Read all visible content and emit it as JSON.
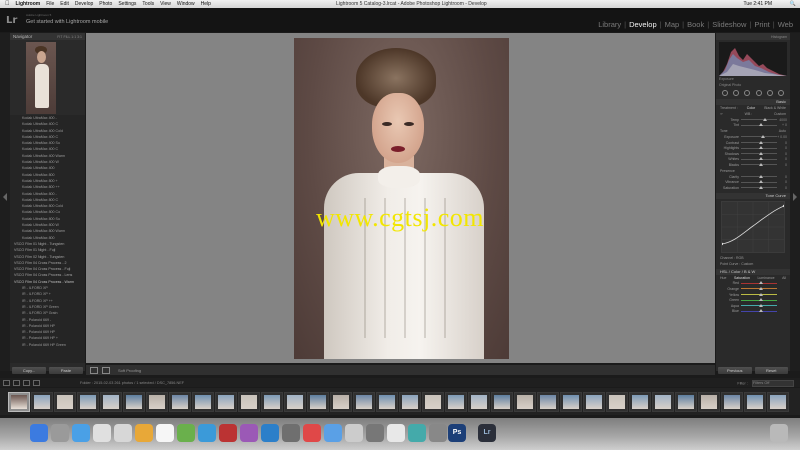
{
  "menubar": {
    "apple": "",
    "app": "Lightroom",
    "items": [
      "File",
      "Edit",
      "Develop",
      "Photo",
      "Settings",
      "Tools",
      "View",
      "Window",
      "Help"
    ],
    "window_title": "Lightroom 5 Catalog-3.lrcat - Adobe Photoshop Lightroom - Develop",
    "clock": "Tue 2:41 PM"
  },
  "identity": {
    "logo": "Lr",
    "small": "Adobe Lightroom 5",
    "text": "Get started with Lightroom mobile",
    "modules": [
      "Library",
      "Develop",
      "Map",
      "Book",
      "Slideshow",
      "Print",
      "Web"
    ],
    "active_module": "Develop"
  },
  "left_panel": {
    "navigator_title": "Navigator",
    "navigator_zoom": "FIT  FILL  1:1  3:1",
    "presets": [
      "Kodak UltraMax 400 -",
      "Kodak UltraMax 400 C",
      "Kodak UltraMax 400 Cold",
      "Kodak UltraMax 400 C",
      "Kodak UltraMax 400 Su",
      "Kodak UltraMax 400 C",
      "Kodak UltraMax 400 Warm",
      "Kodak UltraMax 400 W",
      "Kodak UltraMax 400",
      "Kodak UltraMax 800",
      "Kodak UltraMax 800 +",
      "Kodak UltraMax 800 ++",
      "Kodak UltraMax 800 -",
      "Kodak UltraMax 800 C",
      "Kodak UltraMax 800 Cold",
      "Kodak UltraMax 800 Co",
      "Kodak UltraMax 800 Su",
      "Kodak UltraMax 800 W",
      "Kodak UltraMax 800 Warm",
      "Kodak UltraMax 800"
    ],
    "folders": [
      "VSCO Film 01 Night - Tungsten",
      "VSCO Film 01 Night - Fuji",
      "VSCO Film 02 Night - Tungsten",
      "VSCO Film 04 Cross Process - 2",
      "VSCO Film 04 Cross Process - Fuji",
      "VSCO Film 04 Cross Process - Lens",
      "VSCO Film 04 Cross Process - Warm"
    ],
    "subitems": [
      "IR - ILFORD XP",
      "IR - ILFORD XP +",
      "IR - ILFORD XP ++",
      "IR - ILFORD XP Green",
      "IR - ILFORD XP Grain",
      "IR - Polaroid 669 -",
      "IR - Polaroid 669 HP",
      "IR - Polaroid 669 HP",
      "IR - Polaroid 669 HP +",
      "IR - Polaroid 669 HP Green"
    ],
    "copy_label": "Copy...",
    "paste_label": "Paste"
  },
  "right_panel": {
    "histogram_title": "Histogram",
    "histo_info": "Exposure",
    "original_photo": "Original Photo",
    "basic_title": "Basic",
    "treatment": "Treatment :",
    "treatment_color": "Color",
    "treatment_bw": "Black & White",
    "wb_label": "WB :",
    "wb_value": "Custom",
    "tone_title": "Tone",
    "tone_auto": "Auto",
    "rows1": [
      {
        "label": "Temp",
        "value": "4000"
      },
      {
        "label": "Tint",
        "value": "+ 0"
      }
    ],
    "rows2": [
      {
        "label": "Exposure",
        "value": "+ 0.00"
      },
      {
        "label": "Contrast",
        "value": "0"
      },
      {
        "label": "Highlights",
        "value": "0"
      },
      {
        "label": "Shadows",
        "value": "0"
      },
      {
        "label": "Whites",
        "value": "0"
      },
      {
        "label": "Blacks",
        "value": "0"
      }
    ],
    "presence_title": "Presence",
    "rows3": [
      {
        "label": "Clarity",
        "value": "0"
      },
      {
        "label": "Vibrance",
        "value": "0"
      },
      {
        "label": "Saturation",
        "value": "0"
      }
    ],
    "tonecurve_title": "Tone Curve",
    "channel_label": "Channel : RGB",
    "point_curve": "Point Curve : Custom",
    "hsl_tabs": [
      "HSL",
      "/",
      "Color",
      "/",
      "B & W"
    ],
    "hsl_subtabs": [
      "Hue",
      "Saturation",
      "Luminance",
      "All"
    ],
    "hsl_rows": [
      "Red",
      "Orange",
      "Yellow",
      "Green",
      "Aqua",
      "Blue"
    ],
    "previous_label": "Previous",
    "reset_label": "Reset"
  },
  "toolbar": {
    "soft_proofing": "Soft Proofing"
  },
  "filmstrip_bar": {
    "path": "Folder : 2015-02-03    261 photos / 1 selected / DSC_7856.NEF",
    "filter_label": "Filter :",
    "filter_value": "Filters Off"
  },
  "watermark": "www.cgtsj.com",
  "dock": {
    "ps_label": "Ps",
    "lr_label": "Lr"
  },
  "colors": {
    "accent": "#f2e600",
    "panel_bg": "#2a2a2a",
    "canvas_bg": "#848484"
  }
}
